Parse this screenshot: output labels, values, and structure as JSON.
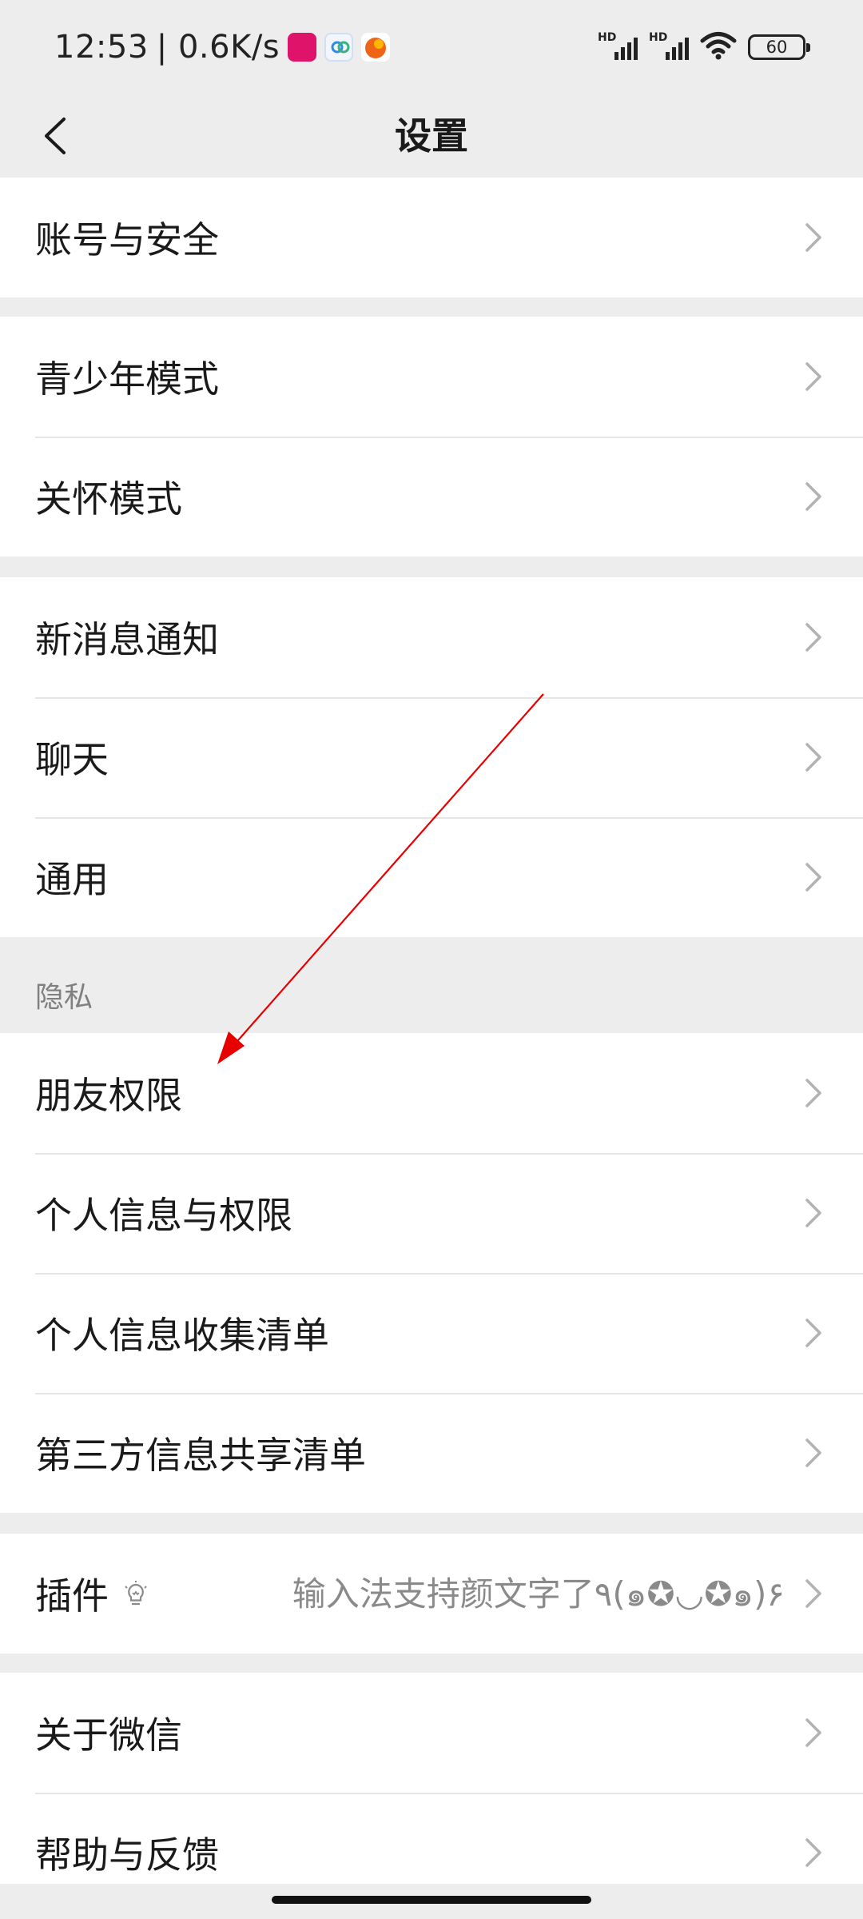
{
  "status_bar": {
    "time": "12:53",
    "net_speed": "| 0.6K/s",
    "signal1_label": "HD",
    "signal2_label": "HD",
    "battery_level": "60",
    "app_icon_colors": [
      "#e0136b",
      "#2e8be6",
      "#f06418"
    ]
  },
  "header": {
    "back_icon": "chevron-left-icon",
    "title": "设置"
  },
  "groups": {
    "account": {
      "items": [
        "账号与安全"
      ]
    },
    "modes": {
      "items": [
        "青少年模式",
        "关怀模式"
      ]
    },
    "general": {
      "items": [
        "新消息通知",
        "聊天",
        "通用"
      ]
    },
    "privacy": {
      "header": "隐私",
      "items": [
        "朋友权限",
        "个人信息与权限",
        "个人信息收集清单",
        "第三方信息共享清单"
      ]
    },
    "plugins": {
      "label": "插件",
      "icon": "lightbulb-icon",
      "value": "输入法支持颜文字了٩(๑✪◡✪๑)۶"
    },
    "about": {
      "items": [
        "关于微信",
        "帮助与反馈"
      ]
    }
  },
  "colors": {
    "background": "#ededed",
    "row_bg": "#ffffff",
    "annotation_arrow": "#e60000"
  }
}
